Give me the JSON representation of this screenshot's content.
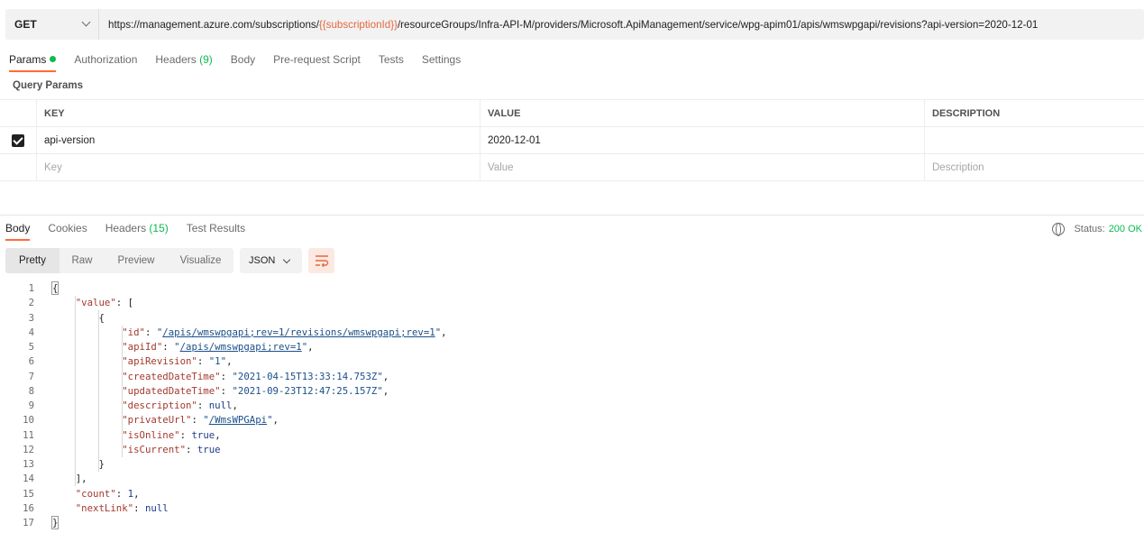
{
  "request": {
    "method": "GET",
    "url_prefix": "https://management.azure.com/subscriptions/",
    "url_var": "{{subscriptionId}}",
    "url_suffix": "/resourceGroups/Infra-API-M/providers/Microsoft.ApiManagement/service/wpg-apim01/apis/wmswpgapi/revisions?api-version=2020-12-01"
  },
  "req_tabs": {
    "params": "Params",
    "authorization": "Authorization",
    "headers": "Headers",
    "headers_count": "(9)",
    "body": "Body",
    "prerequest": "Pre-request Script",
    "tests": "Tests",
    "settings": "Settings"
  },
  "query_params": {
    "title": "Query Params",
    "headers": {
      "key": "KEY",
      "value": "VALUE",
      "description": "DESCRIPTION"
    },
    "rows": [
      {
        "key": "api-version",
        "value": "2020-12-01",
        "description": "",
        "checked": true
      }
    ],
    "placeholders": {
      "key": "Key",
      "value": "Value",
      "description": "Description"
    }
  },
  "res_tabs": {
    "body": "Body",
    "cookies": "Cookies",
    "headers": "Headers",
    "headers_count": "(15)",
    "test_results": "Test Results"
  },
  "status": {
    "label": "Status:",
    "value": "200 OK"
  },
  "view": {
    "pretty": "Pretty",
    "raw": "Raw",
    "preview": "Preview",
    "visualize": "Visualize",
    "format": "JSON"
  },
  "json": {
    "value_key": "\"value\"",
    "id_key": "\"id\"",
    "id_val": "/apis/wmswpgapi;rev=1/revisions/wmswpgapi;rev=1",
    "apiId_key": "\"apiId\"",
    "apiId_val": "/apis/wmswpgapi;rev=1",
    "apiRevision_key": "\"apiRevision\"",
    "apiRevision_val": "\"1\"",
    "createdDateTime_key": "\"createdDateTime\"",
    "createdDateTime_val": "\"2021-04-15T13:33:14.753Z\"",
    "updatedDateTime_key": "\"updatedDateTime\"",
    "updatedDateTime_val": "\"2021-09-23T12:47:25.157Z\"",
    "description_key": "\"description\"",
    "description_val": "null",
    "privateUrl_key": "\"privateUrl\"",
    "privateUrl_val": "/WmsWPGApi",
    "isOnline_key": "\"isOnline\"",
    "isOnline_val": "true",
    "isCurrent_key": "\"isCurrent\"",
    "isCurrent_val": "true",
    "count_key": "\"count\"",
    "count_val": "1",
    "nextLink_key": "\"nextLink\"",
    "nextLink_val": "null"
  },
  "line_numbers": [
    "1",
    "2",
    "3",
    "4",
    "5",
    "6",
    "7",
    "8",
    "9",
    "10",
    "11",
    "12",
    "13",
    "14",
    "15",
    "16",
    "17"
  ],
  "colors": {
    "accent": "#ff6c37",
    "success": "#0cbb52",
    "variable": "#e5683f"
  }
}
